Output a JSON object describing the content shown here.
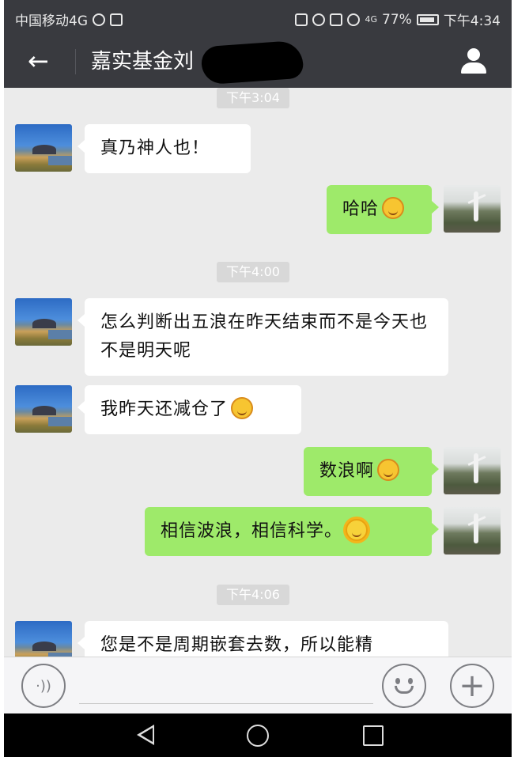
{
  "status_bar": {
    "carrier": "中国移动4G",
    "battery": "77%",
    "time": "下午4:34",
    "network": "4G"
  },
  "header": {
    "back_icon": "arrow-left-icon",
    "title": "嘉实基金刘",
    "contact_icon": "person-icon"
  },
  "messages": [
    {
      "type": "time",
      "text": "下午3:04"
    },
    {
      "type": "in",
      "text": "真乃神人也！"
    },
    {
      "type": "out",
      "text": "哈哈",
      "emoji": "hehe-emoji"
    },
    {
      "type": "time",
      "text": "下午4:00"
    },
    {
      "type": "in",
      "text": "怎么判断出五浪在昨天结束而不是今天也不是明天呢"
    },
    {
      "type": "in",
      "text": "我昨天还减仓了",
      "emoji": "wink-emoji"
    },
    {
      "type": "out",
      "text": "数浪啊",
      "emoji": "grin-emoji"
    },
    {
      "type": "out",
      "text": "相信波浪，相信科学。",
      "emoji": "sun-emoji"
    },
    {
      "type": "time",
      "text": "下午4:06"
    },
    {
      "type": "in",
      "text": "您是不是周期嵌套去数，所以能精"
    }
  ],
  "input_bar": {
    "voice_icon": "voice-icon",
    "emoji_icon": "smiley-icon",
    "plus_icon": "plus-icon"
  },
  "nav_bar": {
    "back": "nav-back-icon",
    "home": "nav-home-icon",
    "recent": "nav-recent-icon"
  },
  "colors": {
    "header_bg": "#393a3f",
    "chat_bg": "#ebebeb",
    "outgoing_bubble": "#9eea6a",
    "incoming_bubble": "#ffffff",
    "timestamp_bg": "#d8d8d8"
  }
}
